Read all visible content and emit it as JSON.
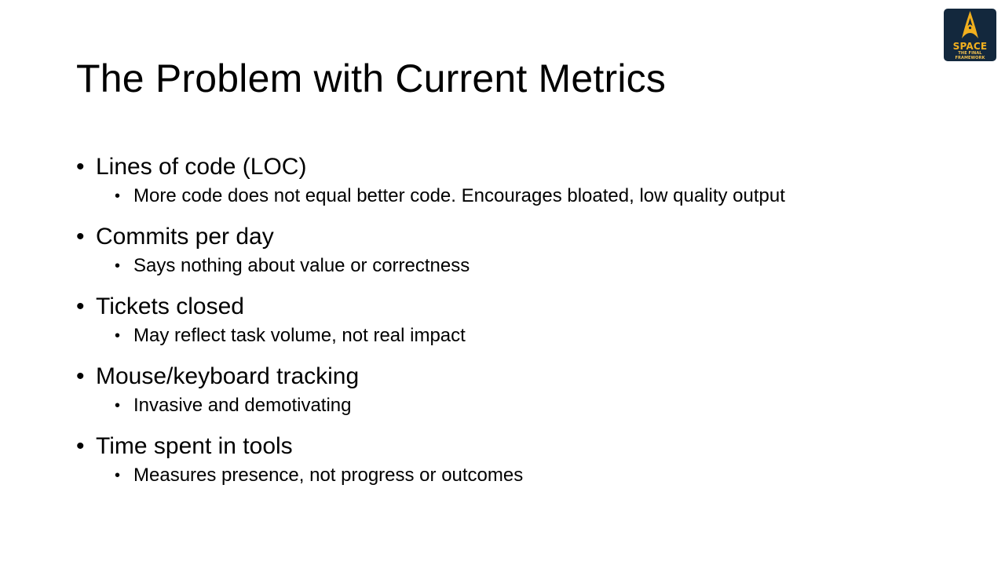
{
  "slide": {
    "title": "The Problem with Current Metrics",
    "bullet_glyph": "•",
    "items": [
      {
        "heading": "Lines of code (LOC)",
        "detail": "More code does not equal better code. Encourages bloated, low quality output"
      },
      {
        "heading": "Commits per day",
        "detail": "Says nothing about value or correctness"
      },
      {
        "heading": "Tickets closed",
        "detail": "May reflect task volume, not real impact"
      },
      {
        "heading": "Mouse/keyboard tracking",
        "detail": "Invasive and demotivating"
      },
      {
        "heading": "Time spent in tools",
        "detail": "Measures presence, not progress or outcomes"
      }
    ]
  },
  "logo": {
    "icon": "starfleet-delta-icon",
    "main_text": "SPACE",
    "sub_text_line1": "THE FINAL",
    "sub_text_line2": "FRAMEWORK",
    "background_color": "#13283d",
    "accent_color": "#f2b01e"
  }
}
